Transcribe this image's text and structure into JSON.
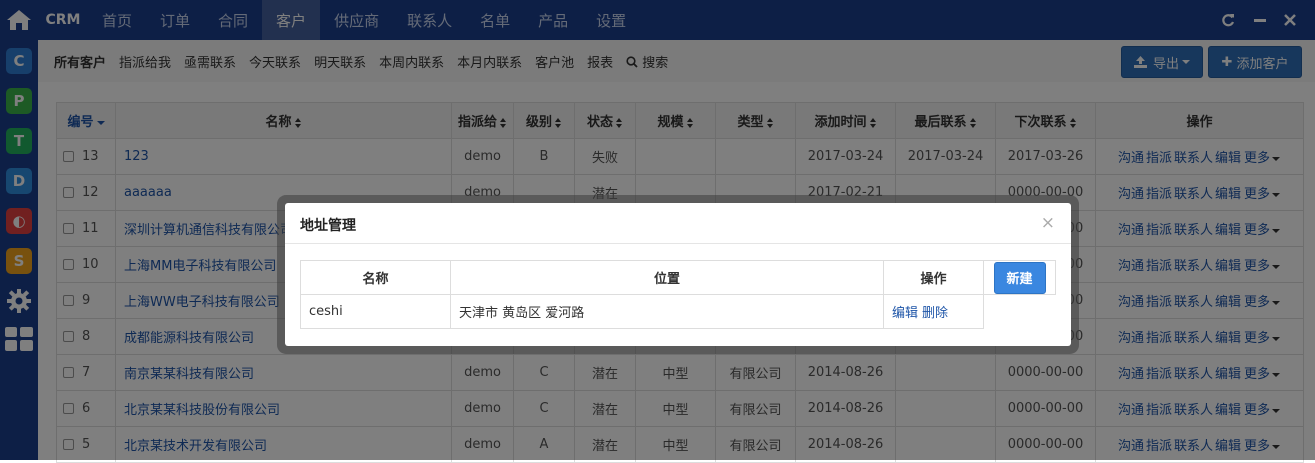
{
  "app": {
    "brand": "CRM"
  },
  "nav": {
    "items": [
      "首页",
      "订单",
      "合同",
      "客户",
      "供应商",
      "联系人",
      "名单",
      "产品",
      "设置"
    ],
    "active": "客户"
  },
  "sidebar": {
    "apps": [
      {
        "letter": "C",
        "color": "#2f7fd6"
      },
      {
        "letter": "P",
        "color": "#3bb54a"
      },
      {
        "letter": "T",
        "color": "#22b35e"
      },
      {
        "letter": "D",
        "color": "#2f8fe0"
      },
      {
        "letter": "◐",
        "color": "#e34040"
      },
      {
        "letter": "S",
        "color": "#f1a21d"
      }
    ]
  },
  "subnav": {
    "items": [
      "所有客户",
      "指派给我",
      "亟需联系",
      "今天联系",
      "明天联系",
      "本周内联系",
      "本月内联系",
      "客户池",
      "报表"
    ],
    "search": "搜索"
  },
  "toolbar": {
    "export": "导出",
    "add": "添加客户"
  },
  "table": {
    "headers": [
      "编号",
      "名称",
      "指派给",
      "级别",
      "状态",
      "规模",
      "类型",
      "添加时间",
      "最后联系",
      "下次联系",
      "操作"
    ],
    "ops": [
      "沟通",
      "指派",
      "联系人",
      "编辑"
    ],
    "more": "更多",
    "rows": [
      {
        "id": "13",
        "name": "123",
        "assign": "demo",
        "level": "B",
        "status": "失败",
        "scale": "",
        "type": "",
        "added": "2017-03-24",
        "last": "2017-03-24",
        "next": "2017-03-26"
      },
      {
        "id": "12",
        "name": "aaaaaa",
        "assign": "demo",
        "level": "",
        "status": "潜在",
        "scale": "",
        "type": "",
        "added": "2017-02-21",
        "last": "",
        "next": "0000-00-00"
      },
      {
        "id": "11",
        "name": "深圳计算机通信科技有限公司",
        "assign": "",
        "level": "",
        "status": "",
        "scale": "",
        "type": "",
        "added": "",
        "last": "",
        "next": "0000-00-00"
      },
      {
        "id": "10",
        "name": "上海MM电子科技有限公司",
        "assign": "",
        "level": "",
        "status": "",
        "scale": "",
        "type": "",
        "added": "",
        "last": "",
        "next": "0000-00-00"
      },
      {
        "id": "9",
        "name": "上海WW电子科技有限公司",
        "assign": "",
        "level": "",
        "status": "",
        "scale": "",
        "type": "",
        "added": "",
        "last": "",
        "next": "0000-00-00"
      },
      {
        "id": "8",
        "name": "成都能源科技有限公司",
        "assign": "",
        "level": "",
        "status": "",
        "scale": "",
        "type": "",
        "added": "",
        "last": "",
        "next": "0000-00-00"
      },
      {
        "id": "7",
        "name": "南京某某科技有限公司",
        "assign": "demo",
        "level": "C",
        "status": "潜在",
        "scale": "中型",
        "type": "有限公司",
        "added": "2014-08-26",
        "last": "",
        "next": "0000-00-00"
      },
      {
        "id": "6",
        "name": "北京某某科技股份有限公司",
        "assign": "demo",
        "level": "C",
        "status": "潜在",
        "scale": "中型",
        "type": "有限公司",
        "added": "2014-08-26",
        "last": "",
        "next": "0000-00-00"
      },
      {
        "id": "5",
        "name": "北京某技术开发有限公司",
        "assign": "demo",
        "level": "A",
        "status": "潜在",
        "scale": "中型",
        "type": "有限公司",
        "added": "2014-08-26",
        "last": "",
        "next": "0000-00-00"
      }
    ]
  },
  "modal": {
    "title": "地址管理",
    "close": "×",
    "headers": [
      "名称",
      "位置",
      "操作"
    ],
    "rows": [
      {
        "name": "ceshi",
        "location": "天津市 黄岛区 爱河路",
        "ops": [
          "编辑",
          "删除"
        ]
      }
    ],
    "new_button": "新建"
  }
}
